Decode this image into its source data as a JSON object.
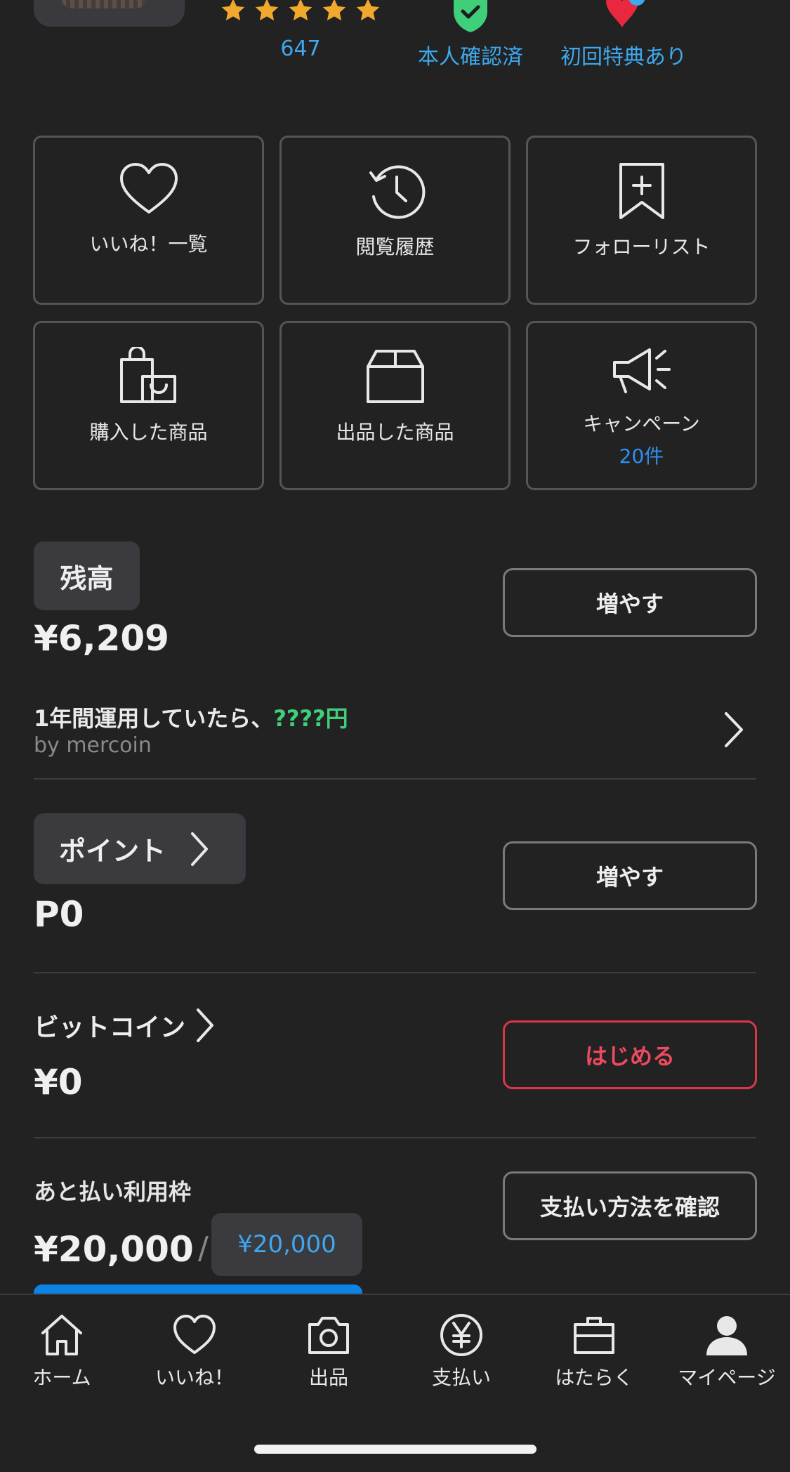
{
  "profile": {
    "rating_stars": 5,
    "rating_count": "647",
    "badges": [
      {
        "label": "本人確認済",
        "icon": "verified-shield-icon"
      },
      {
        "label": "初回特典あり",
        "icon": "heart-balloon-icon"
      }
    ]
  },
  "tiles": [
    {
      "label": "いいね！一覧",
      "icon": "heart-icon"
    },
    {
      "label": "閲覧履歴",
      "icon": "history-clock-icon"
    },
    {
      "label": "フォローリスト",
      "icon": "bookmark-plus-icon"
    },
    {
      "label": "購入した商品",
      "icon": "shopping-bag-icon"
    },
    {
      "label": "出品した商品",
      "icon": "box-icon"
    },
    {
      "label": "キャンペーン",
      "sub": "20件",
      "icon": "megaphone-icon"
    }
  ],
  "balance": {
    "label": "残高",
    "amount": "¥6,209",
    "button": "増やす"
  },
  "promo": {
    "title_prefix": "1年間運用していたら、",
    "title_highlight": "????円",
    "by": "by mercoin"
  },
  "points": {
    "label": "ポイント",
    "amount": "P0",
    "button": "増やす"
  },
  "bitcoin": {
    "label": "ビットコイン",
    "amount": "¥0",
    "button": "はじめる"
  },
  "deferred": {
    "label": "あと払い利用枠",
    "amount": "¥20,000",
    "separator": "/",
    "limit": "¥20,000",
    "button": "支払い方法を確認"
  },
  "nav": [
    {
      "label": "ホーム",
      "icon": "home-icon"
    },
    {
      "label": "いいね！",
      "icon": "heart-icon"
    },
    {
      "label": "出品",
      "icon": "camera-icon"
    },
    {
      "label": "支払い",
      "icon": "yen-circle-icon"
    },
    {
      "label": "はたらく",
      "icon": "briefcase-icon"
    },
    {
      "label": "マイページ",
      "icon": "person-icon"
    }
  ],
  "colors": {
    "background": "#222222",
    "accent_blue": "#3ea8ee",
    "link_blue": "#2f8ff0",
    "star": "#f0a92d",
    "green": "#3fce7a",
    "red": "#ec4a5e"
  }
}
